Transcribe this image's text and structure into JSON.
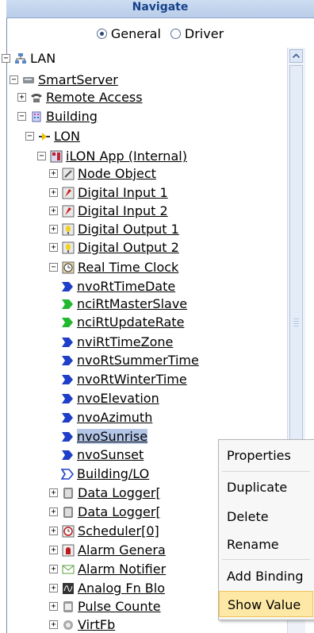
{
  "panel": {
    "title": "Navigate"
  },
  "view_mode": {
    "general_label": "General",
    "driver_label": "Driver",
    "selected": "General"
  },
  "tree": {
    "items": [
      {
        "label": "LAN",
        "icon": "network-icon",
        "toggle": "minus",
        "underlined": false
      },
      {
        "label": "SmartServer",
        "icon": "server-icon",
        "toggle": "minus",
        "underlined": true
      },
      {
        "label": "Remote Access",
        "icon": "phone-icon",
        "toggle": "plus",
        "underlined": true
      },
      {
        "label": "Building",
        "icon": "building-icon",
        "toggle": "minus",
        "underlined": true
      },
      {
        "label": "LON",
        "icon": "lon-channel-icon",
        "toggle": "minus",
        "underlined": true
      },
      {
        "label": "iLON App (Internal)",
        "icon": "device-icon",
        "toggle": "minus",
        "underlined": true
      },
      {
        "label": "Node Object",
        "icon": "node-object-icon",
        "toggle": "plus",
        "underlined": true
      },
      {
        "label": "Digital Input 1",
        "icon": "digital-input-icon",
        "toggle": "plus",
        "underlined": true
      },
      {
        "label": "Digital Input 2",
        "icon": "digital-input-icon",
        "toggle": "plus",
        "underlined": true
      },
      {
        "label": "Digital Output 1",
        "icon": "digital-output-icon",
        "toggle": "plus",
        "underlined": true
      },
      {
        "label": "Digital Output 2",
        "icon": "digital-output-icon",
        "toggle": "plus",
        "underlined": true
      },
      {
        "label": "Real Time Clock",
        "icon": "clock-icon",
        "toggle": "minus",
        "underlined": true
      },
      {
        "label": "nvoRtTimeDate",
        "icon": "output-datapoint-icon",
        "toggle": "",
        "underlined": true
      },
      {
        "label": "nciRtMasterSlave",
        "icon": "config-datapoint-icon",
        "toggle": "",
        "underlined": true
      },
      {
        "label": "nciRtUpdateRate",
        "icon": "config-datapoint-icon",
        "toggle": "",
        "underlined": true
      },
      {
        "label": "nviRtTimeZone",
        "icon": "input-datapoint-icon",
        "toggle": "",
        "underlined": true
      },
      {
        "label": "nvoRtSummerTime",
        "icon": "output-datapoint-icon",
        "toggle": "",
        "underlined": true
      },
      {
        "label": "nvoRtWinterTime",
        "icon": "output-datapoint-icon",
        "toggle": "",
        "underlined": true
      },
      {
        "label": "nvoElevation",
        "icon": "output-datapoint-icon",
        "toggle": "",
        "underlined": true
      },
      {
        "label": "nvoAzimuth",
        "icon": "output-datapoint-icon",
        "toggle": "",
        "underlined": true
      },
      {
        "label": "nvoSunrise",
        "icon": "output-datapoint-icon",
        "toggle": "",
        "underlined": true
      },
      {
        "label": "nvoSunset",
        "icon": "output-datapoint-icon",
        "toggle": "",
        "underlined": true
      },
      {
        "label": "Building/LO",
        "icon": "binding-icon",
        "toggle": "",
        "underlined": true
      },
      {
        "label": "Data Logger[",
        "icon": "data-logger-icon",
        "toggle": "plus",
        "underlined": true
      },
      {
        "label": "Data Logger[",
        "icon": "data-logger-icon",
        "toggle": "plus",
        "underlined": true
      },
      {
        "label": "Scheduler[0]",
        "icon": "scheduler-icon",
        "toggle": "plus",
        "underlined": true
      },
      {
        "label": "Alarm Genera",
        "icon": "alarm-generator-icon",
        "toggle": "plus",
        "underlined": true
      },
      {
        "label": "Alarm Notifier",
        "icon": "alarm-notifier-icon",
        "toggle": "plus",
        "underlined": true
      },
      {
        "label": "Analog Fn Blo",
        "icon": "analog-function-icon",
        "toggle": "plus",
        "underlined": true
      },
      {
        "label": "Pulse Counte",
        "icon": "pulse-counter-icon",
        "toggle": "plus",
        "underlined": true
      },
      {
        "label": "VirtFb",
        "icon": "virtual-fb-icon",
        "toggle": "plus",
        "underlined": true
      }
    ],
    "selected_item": "nvoSunrise"
  },
  "context_menu": {
    "items": [
      {
        "label": "Properties",
        "highlighted": false
      },
      {
        "label": "Duplicate",
        "highlighted": false
      },
      {
        "label": "Delete",
        "highlighted": false
      },
      {
        "label": "Rename",
        "highlighted": false
      },
      {
        "label": "Add Binding",
        "highlighted": false
      },
      {
        "label": "Show Value",
        "highlighted": true
      }
    ]
  },
  "colors": {
    "header_text": "#15428b",
    "selection": "#b4c6e8",
    "menu_highlight": "#fde8a6"
  }
}
